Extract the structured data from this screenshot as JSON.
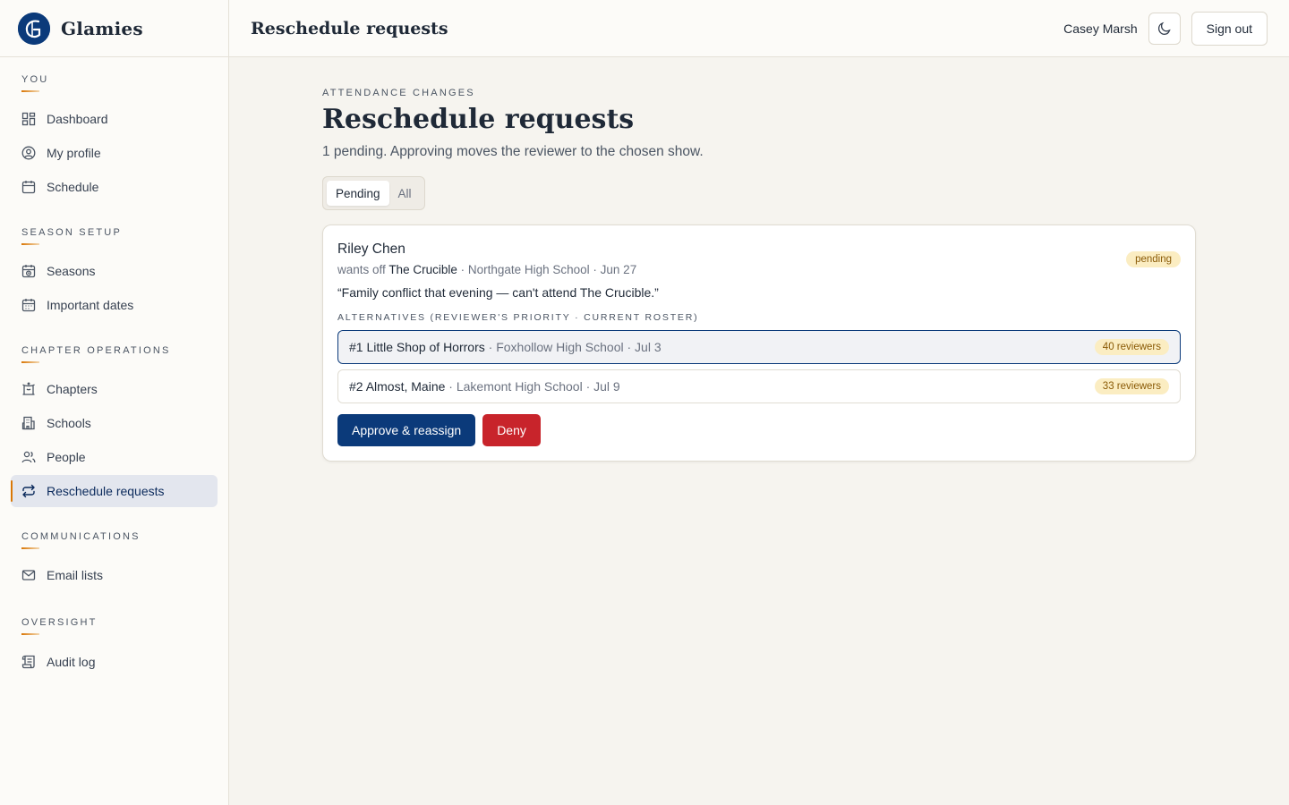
{
  "app": {
    "name": "Glamies",
    "logo_icon": "glamies-logo-icon"
  },
  "header": {
    "title": "Reschedule requests",
    "user_name": "Casey Marsh",
    "theme_icon": "moon-icon",
    "sign_out_label": "Sign out"
  },
  "sidebar": {
    "sections": [
      {
        "label": "You",
        "items": [
          {
            "label": "Dashboard",
            "icon": "dashboard-icon"
          },
          {
            "label": "My profile",
            "icon": "user-circle-icon"
          },
          {
            "label": "Schedule",
            "icon": "calendar-icon"
          }
        ]
      },
      {
        "label": "Season setup",
        "items": [
          {
            "label": "Seasons",
            "icon": "calendar-clock-icon"
          },
          {
            "label": "Important dates",
            "icon": "calendar-grid-icon"
          }
        ]
      },
      {
        "label": "Chapter operations",
        "items": [
          {
            "label": "Chapters",
            "icon": "theater-icon"
          },
          {
            "label": "Schools",
            "icon": "building-icon"
          },
          {
            "label": "People",
            "icon": "users-icon"
          },
          {
            "label": "Reschedule requests",
            "icon": "repeat-icon",
            "active": true
          }
        ]
      },
      {
        "label": "Communications",
        "items": [
          {
            "label": "Email lists",
            "icon": "mail-icon"
          }
        ]
      },
      {
        "label": "Oversight",
        "items": [
          {
            "label": "Audit log",
            "icon": "scroll-icon"
          }
        ]
      }
    ]
  },
  "main": {
    "eyebrow": "Attendance changes",
    "title": "Reschedule requests",
    "subtitle": "1 pending. Approving moves the reviewer to the chosen show.",
    "filter": {
      "options": [
        "Pending",
        "All"
      ],
      "selected": "Pending"
    },
    "request": {
      "name": "Riley Chen",
      "wants_off_prefix": "wants off",
      "show": "The Crucible",
      "details": " · Northgate High School · Jun 27",
      "status": "pending",
      "reason": "“Family conflict that evening — can't attend The Crucible.”",
      "alternatives_label": "Alternatives (reviewer's priority · current roster)",
      "alternatives": [
        {
          "rank_show": "#1 Little Shop of Horrors",
          "details": " · Foxhollow High School · Jul 3",
          "roster": "40 reviewers",
          "selected": true
        },
        {
          "rank_show": "#2 Almost, Maine",
          "details": " · Lakemont High School · Jul 9",
          "roster": "33 reviewers",
          "selected": false
        }
      ],
      "approve_label": "Approve & reassign",
      "deny_label": "Deny"
    }
  },
  "colors": {
    "brand": "#0b3a7a",
    "accent": "#d97706",
    "danger": "#c8242b",
    "badge_bg": "#fbedc2"
  }
}
